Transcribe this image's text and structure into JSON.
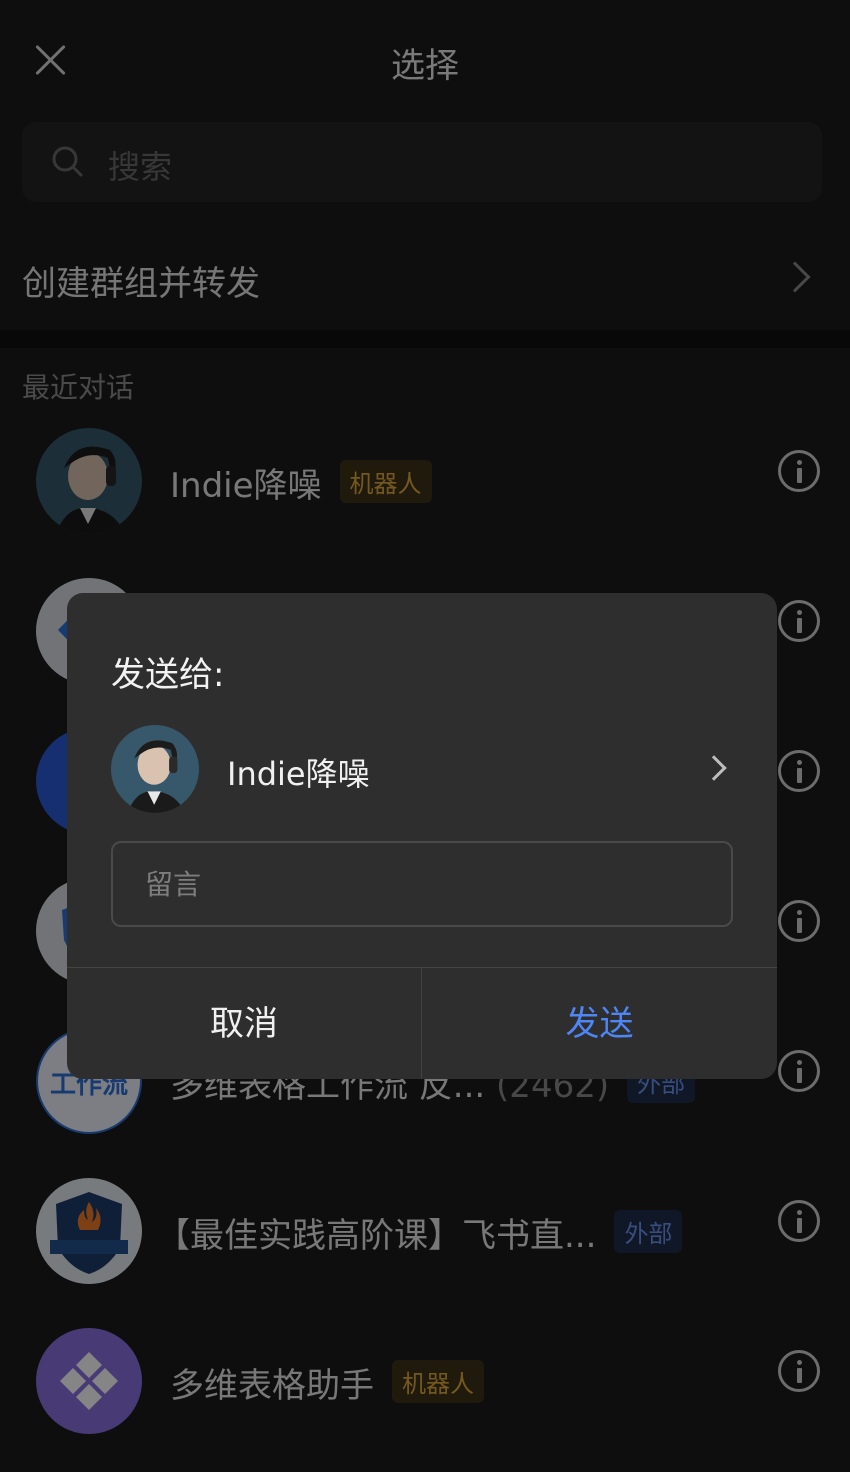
{
  "header": {
    "title": "选择"
  },
  "search": {
    "placeholder": "搜索"
  },
  "create_group": {
    "label": "创建群组并转发"
  },
  "recent": {
    "title": "最近对话",
    "items": [
      {
        "name": "Indie降噪",
        "tag": "机器人",
        "tag_kind": "bot",
        "avatar": "portrait"
      },
      {
        "name": "",
        "tag": "",
        "avatar": "logo-diamond"
      },
      {
        "name": "",
        "tag": "",
        "avatar": "logo-blue"
      },
      {
        "name": "",
        "tag": "",
        "avatar": "logo-shield"
      },
      {
        "name": "多维表格工作流 反...",
        "count": "(2462)",
        "tag": "外部",
        "tag_kind": "ext",
        "avatar_text": "工作流"
      },
      {
        "name": "【最佳实践高阶课】飞书直...",
        "tag": "外部",
        "tag_kind": "ext",
        "avatar": "course-badge"
      },
      {
        "name": "多维表格助手",
        "tag": "机器人",
        "tag_kind": "bot",
        "avatar": "bitable-logo"
      }
    ]
  },
  "dialog": {
    "heading": "发送给:",
    "recipient": "Indie降噪",
    "message_placeholder": "留言",
    "cancel_label": "取消",
    "send_label": "发送"
  },
  "colors": {
    "accent": "#4e86f5",
    "bot_tag": "#e0a93a",
    "ext_tag": "#6b95f0"
  }
}
